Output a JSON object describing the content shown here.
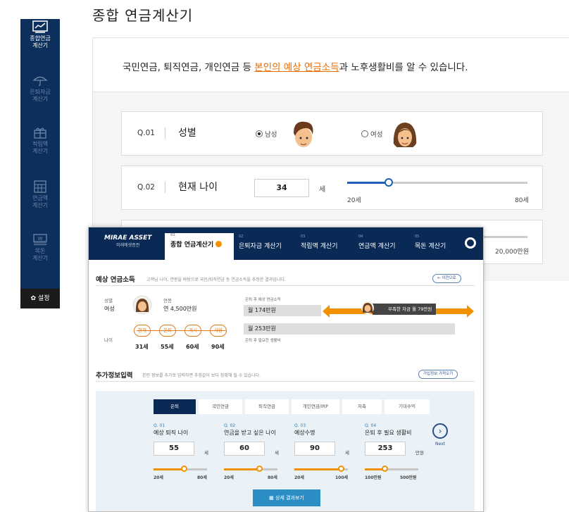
{
  "sidebar": {
    "items": [
      {
        "label_1": "종합연금",
        "label_2": "계산기",
        "icon": "chart-icon"
      },
      {
        "label_1": "은퇴자금",
        "label_2": "계산기",
        "icon": "umbrella-icon"
      },
      {
        "label_1": "적립액",
        "label_2": "계산기",
        "icon": "gift-icon"
      },
      {
        "label_1": "연금액",
        "label_2": "계산기",
        "icon": "table-icon"
      },
      {
        "label_1": "목돈",
        "label_2": "계산기",
        "icon": "money-icon"
      }
    ],
    "settings": "설정"
  },
  "page_title": "종합 연금계산기",
  "intro": {
    "before": "국민연금, 퇴직연금, 개인연금 등 ",
    "highlight": "본인의 예상 연금소득",
    "after": "과 노후생활비를 알 수 있습니다."
  },
  "q1": {
    "num": "Q.01",
    "label": "성별",
    "male": "남성",
    "female": "여성",
    "selected": "male"
  },
  "q2": {
    "num": "Q.02",
    "label": "현재 나이",
    "value": "34",
    "unit": "세",
    "min": "20세",
    "max": "80세",
    "level": 0.23
  },
  "q3": {
    "max": "20,000만원"
  },
  "overlay": {
    "logo": "MIRAE ASSET",
    "logo_sub": "미래에셋증권",
    "tabs": [
      {
        "n": "01",
        "label": "종합 연금계산기"
      },
      {
        "n": "02",
        "label": "은퇴자금 계산기"
      },
      {
        "n": "03",
        "label": "적립액 계산기"
      },
      {
        "n": "04",
        "label": "연금액 계산기"
      },
      {
        "n": "05",
        "label": "목돈 계산기"
      }
    ],
    "section1": {
      "title": "예상 연금소득",
      "desc": "고객님 나이, 연봉을 바탕으로 국민/퇴직연금 등 연금소득을 추정한 결과입니다.",
      "prev": "← 이전으로",
      "gender_label": "성별",
      "gender": "여성",
      "salary_label": "연봉",
      "salary": "연 4,500만원",
      "age_label": "나이",
      "stages": [
        "현재",
        "은퇴",
        "개시",
        "사망"
      ],
      "ages": [
        "31세",
        "55세",
        "60세",
        "90세"
      ],
      "income_label": "은퇴 후 예상 연금소득",
      "income": "월 174만원",
      "need": "월 253만원",
      "need_label": "은퇴 후 필요한 생활비",
      "tip": "부족한 자금 월 79만원"
    },
    "section2": {
      "title": "추가정보입력",
      "desc": "본인 정보를 추가로 입력하면 추정값이 보다 정확해 질 수 있습니다.",
      "import": "가입정보 가져오기",
      "steps": [
        "은퇴",
        "국민연금",
        "퇴직연금",
        "개인연금/IRP",
        "저축",
        "기대수익"
      ],
      "fields": [
        {
          "num": "Q. 01",
          "label": "예상 퇴직 나이",
          "value": "55",
          "unit": "세",
          "lo": "20세",
          "hi": "80세",
          "level": 0.58
        },
        {
          "num": "Q. 02",
          "label": "연금을 받고 싶은 나이",
          "value": "60",
          "unit": "세",
          "lo": "20세",
          "hi": "80세",
          "level": 0.67
        },
        {
          "num": "Q. 03",
          "label": "예상수명",
          "value": "90",
          "unit": "세",
          "lo": "20세",
          "hi": "100세",
          "level": 0.88
        },
        {
          "num": "Q. 04",
          "label": "은퇴 후 필요 생활비",
          "value": "253",
          "unit": "만원",
          "lo": "100만원",
          "hi": "500만원",
          "level": 0.38
        }
      ],
      "next": "Next",
      "detail": "상세 결과보기"
    }
  },
  "colors": {
    "navy": "#0c2f5c",
    "accent": "#e86c00",
    "blue": "#1f5fb8"
  }
}
